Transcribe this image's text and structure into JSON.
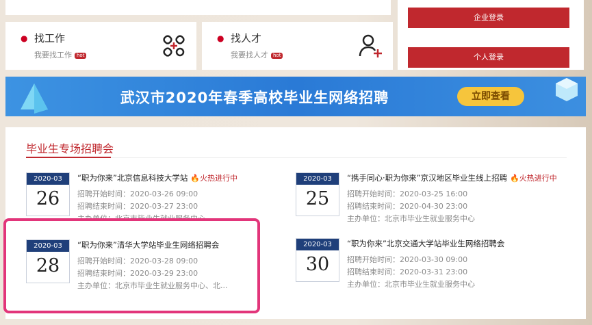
{
  "quick": {
    "find_job": {
      "title": "找工作",
      "sub": "我要找工作",
      "badge": "hot"
    },
    "find_talent": {
      "title": "找人才",
      "sub": "我要找人才",
      "badge": "hot"
    }
  },
  "login": {
    "company": "企业登录",
    "personal": "个人登录"
  },
  "banner": {
    "text": "武汉市2020年春季高校毕业生网络招聘",
    "cta": "立即查看"
  },
  "section": {
    "title": "毕业生专场招聘会"
  },
  "fairs": [
    {
      "month": "2020-03",
      "day": "26",
      "title": "“职为你来”北京信息科技大学站",
      "hot": "火热进行中",
      "start": "招聘开始时间：2020-03-26 09:00",
      "end": "招聘结束时间：2020-03-27 23:00",
      "host": "主办单位：北京市毕业生就业服务中心"
    },
    {
      "month": "2020-03",
      "day": "25",
      "title": "“携手同心·职为你来”京汉地区毕业生线上招聘",
      "hot": "火热进行中",
      "start": "招聘开始时间：2020-03-25 16:00",
      "end": "招聘结束时间：2020-04-30 23:00",
      "host": "主办单位：北京市毕业生就业服务中心"
    },
    {
      "month": "2020-03",
      "day": "28",
      "title": "“职为你来”清华大学站毕业生网络招聘会",
      "hot": "",
      "start": "招聘开始时间：2020-03-28 09:00",
      "end": "招聘结束时间：2020-03-29 23:00",
      "host": "主办单位：北京市毕业生就业服务中心、北..."
    },
    {
      "month": "2020-03",
      "day": "30",
      "title": "“职为你来”北京交通大学站毕业生网络招聘会",
      "hot": "",
      "start": "招聘开始时间：2020-03-30 09:00",
      "end": "招聘结束时间：2020-03-31 23:00",
      "host": "主办单位：北京市毕业生就业服务中心"
    }
  ],
  "colors": {
    "accent": "#c0282e",
    "calendar": "#1f3f7a",
    "banner": "#2a7ad6",
    "highlight": "#e2357a"
  }
}
